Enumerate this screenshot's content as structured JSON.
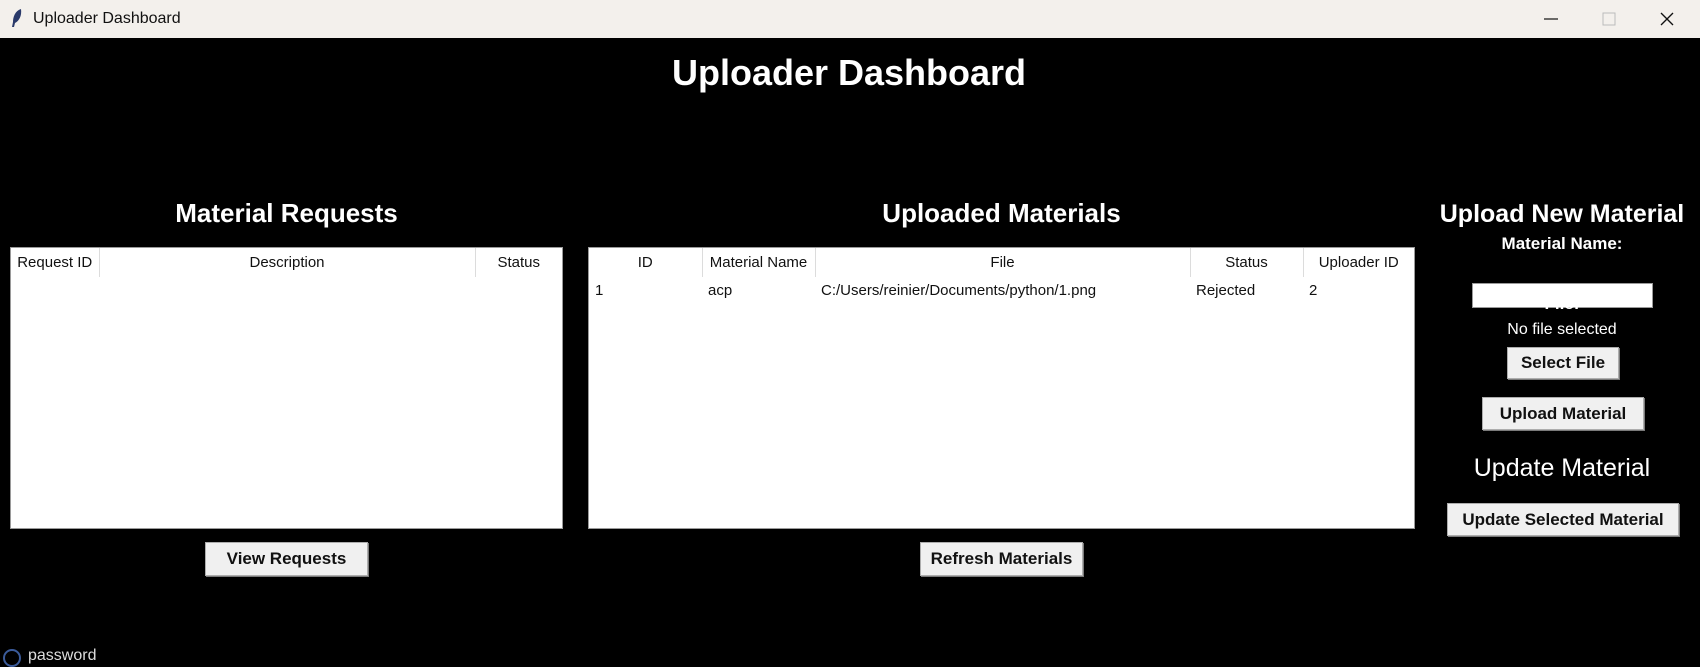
{
  "window": {
    "title": "Uploader Dashboard"
  },
  "dashboard": {
    "title": "Uploader Dashboard"
  },
  "requests": {
    "title": "Material Requests",
    "columns": [
      "Request ID",
      "Description",
      "Status"
    ],
    "rows": [],
    "button": "View Requests"
  },
  "materials": {
    "title": "Uploaded Materials",
    "columns": [
      "ID",
      "Material Name",
      "File",
      "Status",
      "Uploader ID"
    ],
    "rows": [
      [
        "1",
        "acp",
        "C:/Users/reinier/Documents/python/1.png",
        "Rejected",
        "2"
      ]
    ],
    "button": "Refresh Materials"
  },
  "upload": {
    "title": "Upload New Material",
    "name_label": "Material Name:",
    "name_value": "",
    "file_label": "File:",
    "file_status": "No file selected",
    "select_button": "Select File",
    "upload_button": "Upload Material",
    "update_title": "Update Material",
    "update_button": "Update Selected Material"
  },
  "background_window": {
    "partial_text": "password"
  }
}
